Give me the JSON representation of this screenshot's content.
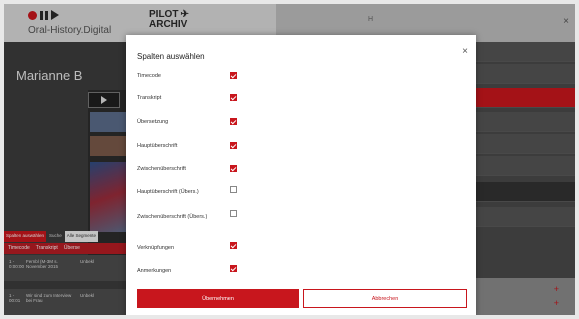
{
  "header": {
    "brand_name": "Oral-History.Digital",
    "pilot_line1": "PILOT",
    "pilot_line2": "ARCHIV",
    "right_label": "H",
    "close": "×",
    "icons": [
      "record-dot-icon",
      "pause-icon",
      "play-icon",
      "plane-icon"
    ]
  },
  "left_panel": {
    "person_name": "Marianne B",
    "filter_bar": {
      "button": "Spalten auswählen",
      "label": "Suche",
      "field": "Alle Segmente"
    },
    "tabs": [
      "Timecode",
      "Transkript",
      "Überse"
    ],
    "rows": [
      {
        "c1": "1 - 0:00:00",
        "c2": "Fernbl (M-3M s. November 2015",
        "c3": "Unbekl"
      },
      {
        "c1": "1 - 00:01",
        "c2": "Wir sind zum Interview bei Frau",
        "c3": "Unbekl"
      }
    ]
  },
  "modal": {
    "title": "Spalten auswählen",
    "close": "×",
    "options": [
      {
        "label": "Timecode",
        "checked": true
      },
      {
        "label": "Transkript",
        "checked": true
      },
      {
        "label": "Übersetzung",
        "checked": true
      },
      {
        "label": "Hauptüberschrift",
        "checked": true
      },
      {
        "label": "Zwischenüberschrift",
        "checked": true
      },
      {
        "label": "Hauptüberschrift (Übers.)",
        "checked": false
      },
      {
        "label": "Zwischenüberschrift (Übers.)",
        "checked": false
      },
      {
        "label": "Verknüpfungen",
        "checked": true
      },
      {
        "label": "Anmerkungen",
        "checked": true
      }
    ],
    "apply_label": "Übernehmen",
    "cancel_label": "Abbrechen"
  },
  "colors": {
    "accent": "#c8161d",
    "header_bg": "#d9d9d9",
    "panel_dark": "#3c3c3c"
  }
}
